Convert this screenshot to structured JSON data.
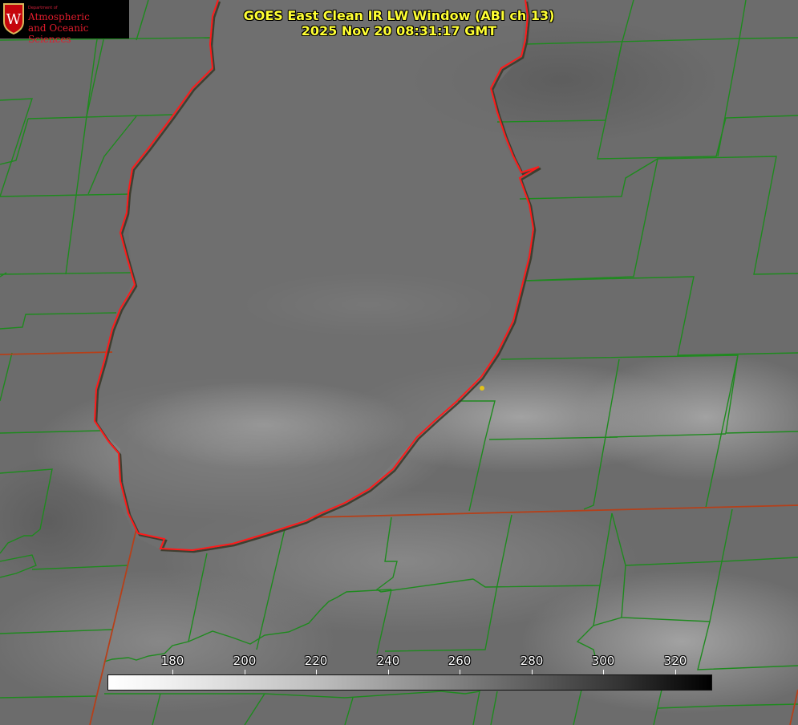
{
  "title_line1": "GOES East Clean IR LW Window (ABI ch 13)",
  "title_line2": "2025 Nov 20 08:31:17 GMT",
  "logo": {
    "dept": "Department of",
    "line1": "Atmospheric",
    "line2": "and Oceanic Sciences",
    "letter": "W"
  },
  "colorbar": {
    "ticks": [
      "180",
      "200",
      "220",
      "240",
      "260",
      "280",
      "300",
      "320"
    ],
    "gradient": "white to black"
  },
  "colors": {
    "county_lines": "#1e8a1e",
    "state_lines": "#b5401a",
    "lake_outline": "#ff1a1a",
    "title_text": "#ffff33",
    "station_dot": "#e2c21a"
  }
}
